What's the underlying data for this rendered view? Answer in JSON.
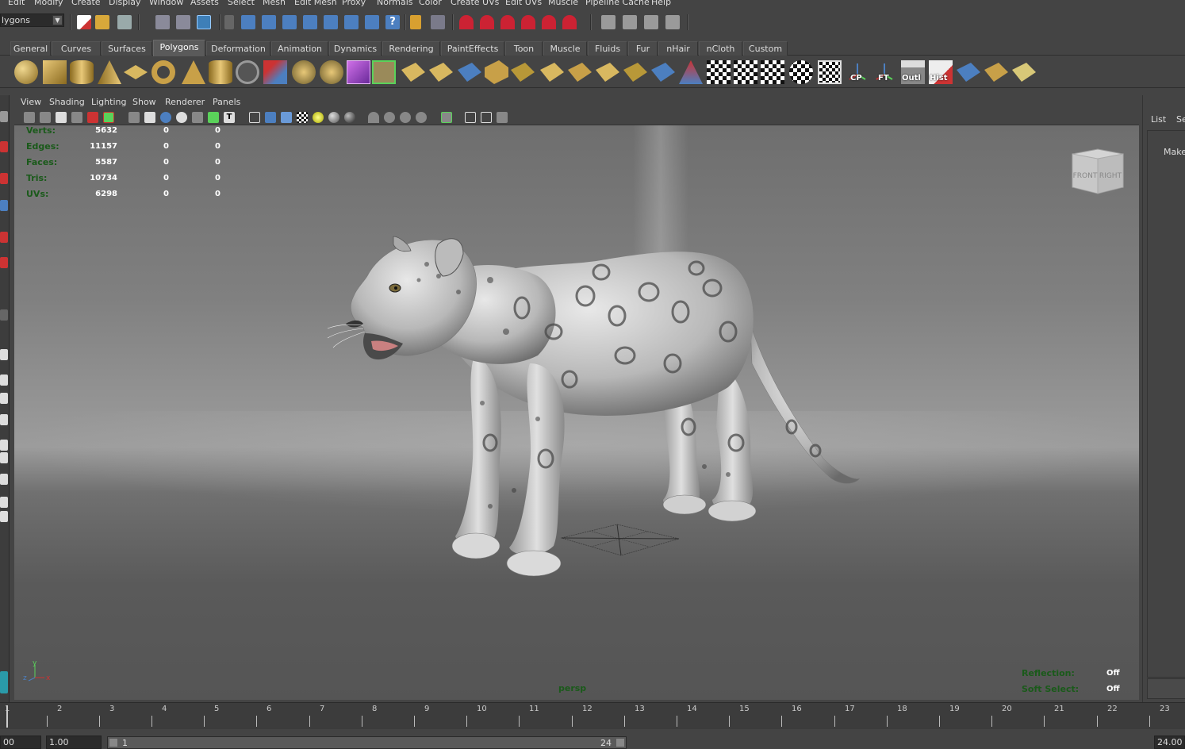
{
  "menu": [
    "Edit",
    "Modify",
    "Create",
    "Display",
    "Window",
    "Assets",
    "Select",
    "Mesh",
    "Edit Mesh",
    "Proxy",
    "Normals",
    "Color",
    "Create UVs",
    "Edit UVs",
    "Muscle",
    "Pipeline Cache",
    "Help"
  ],
  "mode_select": {
    "value": "lygons"
  },
  "shelf_tabs": [
    "General",
    "Curves",
    "Surfaces",
    "Polygons",
    "Deformation",
    "Animation",
    "Dynamics",
    "Rendering",
    "PaintEffects",
    "Toon",
    "Muscle",
    "Fluids",
    "Fur",
    "nHair",
    "nCloth",
    "Custom"
  ],
  "active_shelf_tab": "Polygons",
  "shelf_labels": {
    "cp": "CP",
    "ft": "FT",
    "outl": "Outl",
    "hist": "Hist"
  },
  "panel_menu": [
    "View",
    "Shading",
    "Lighting",
    "Show",
    "Renderer",
    "Panels"
  ],
  "hud": {
    "rows": [
      {
        "label": "Verts:",
        "v1": "5632",
        "v2": "0",
        "v3": "0"
      },
      {
        "label": "Edges:",
        "v1": "11157",
        "v2": "0",
        "v3": "0"
      },
      {
        "label": "Faces:",
        "v1": "5587",
        "v2": "0",
        "v3": "0"
      },
      {
        "label": "Tris:",
        "v1": "10734",
        "v2": "0",
        "v3": "0"
      },
      {
        "label": "UVs:",
        "v1": "6298",
        "v2": "0",
        "v3": "0"
      }
    ],
    "reflection_label": "Reflection:",
    "reflection_value": "Off",
    "soft_select_label": "Soft Select:",
    "soft_select_value": "Off",
    "camera": "persp"
  },
  "viewcube": {
    "front": "FRONT",
    "right": "RIGHT"
  },
  "axis": {
    "x": "x",
    "y": "y",
    "z": "z"
  },
  "right_panel": {
    "tab_list": "List",
    "tab_sel": "Se",
    "make": "Make"
  },
  "timeline": {
    "ticks": [
      "1",
      "2",
      "3",
      "4",
      "5",
      "6",
      "7",
      "8",
      "9",
      "10",
      "11",
      "12",
      "13",
      "14",
      "15",
      "16",
      "17",
      "18",
      "19",
      "20",
      "21",
      "22",
      "23"
    ]
  },
  "range": {
    "start_cut": "00",
    "start": "1.00",
    "slider_start": "1",
    "slider_end": "24",
    "end": "24.00"
  }
}
